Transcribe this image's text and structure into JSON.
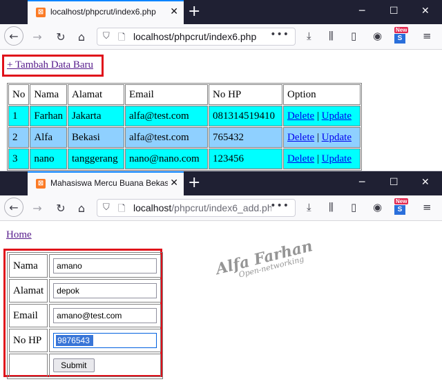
{
  "window1": {
    "tab_title": "localhost/phpcrut/index6.php",
    "url": "localhost/phpcrut/index6.php",
    "add_link": "+ Tambah Data Baru",
    "table": {
      "headers": [
        "No",
        "Nama",
        "Alamat",
        "Email",
        "No HP",
        "Option"
      ],
      "rows": [
        {
          "no": "1",
          "nama": "Farhan",
          "alamat": "Jakarta",
          "email": "alfa@test.com",
          "hp": "081314519410",
          "delete": "Delete",
          "sep": "|",
          "update": "Update"
        },
        {
          "no": "2",
          "nama": "Alfa",
          "alamat": "Bekasi",
          "email": "alfa@test.com",
          "hp": "765432",
          "delete": "Delete",
          "sep": "|",
          "update": "Update"
        },
        {
          "no": "3",
          "nama": "nano",
          "alamat": "tanggerang",
          "email": "nano@nano.com",
          "hp": "123456",
          "delete": "Delete",
          "sep": "|",
          "update": "Update"
        }
      ],
      "row_colors": [
        "#00ffff",
        "#8fd0ff",
        "#00ffff"
      ]
    }
  },
  "window2": {
    "tab_title": "Mahasiswa Mercu Buana Bekasi",
    "url_host": "localhost",
    "url_path": "/phpcrut/index6_add.ph",
    "home_link": "Home",
    "form": {
      "nama_label": "Nama",
      "nama_value": "amano",
      "alamat_label": "Alamat",
      "alamat_value": "depok",
      "email_label": "Email",
      "email_value": "amano@test.com",
      "hp_label": "No HP",
      "hp_value": "9876543",
      "submit_label": "Submit"
    }
  },
  "watermark": {
    "line1": "Alfa Farhan",
    "line2": "Open-networking"
  },
  "badge": "New",
  "icons": {
    "back": "←",
    "forward": "→",
    "reload": "↻",
    "home": "⌂",
    "shield": "⛉",
    "page": "🗋",
    "more": "•••",
    "download": "⤓",
    "library": "⫼",
    "sidebar": "▯",
    "account": "◉",
    "menu": "≡",
    "close": "✕",
    "plus": "+",
    "minimize": "─",
    "maximize": "☐"
  },
  "colors": {
    "accent": "#0a84ff",
    "redbox": "#e0101a",
    "titlebar": "#1f2033"
  }
}
